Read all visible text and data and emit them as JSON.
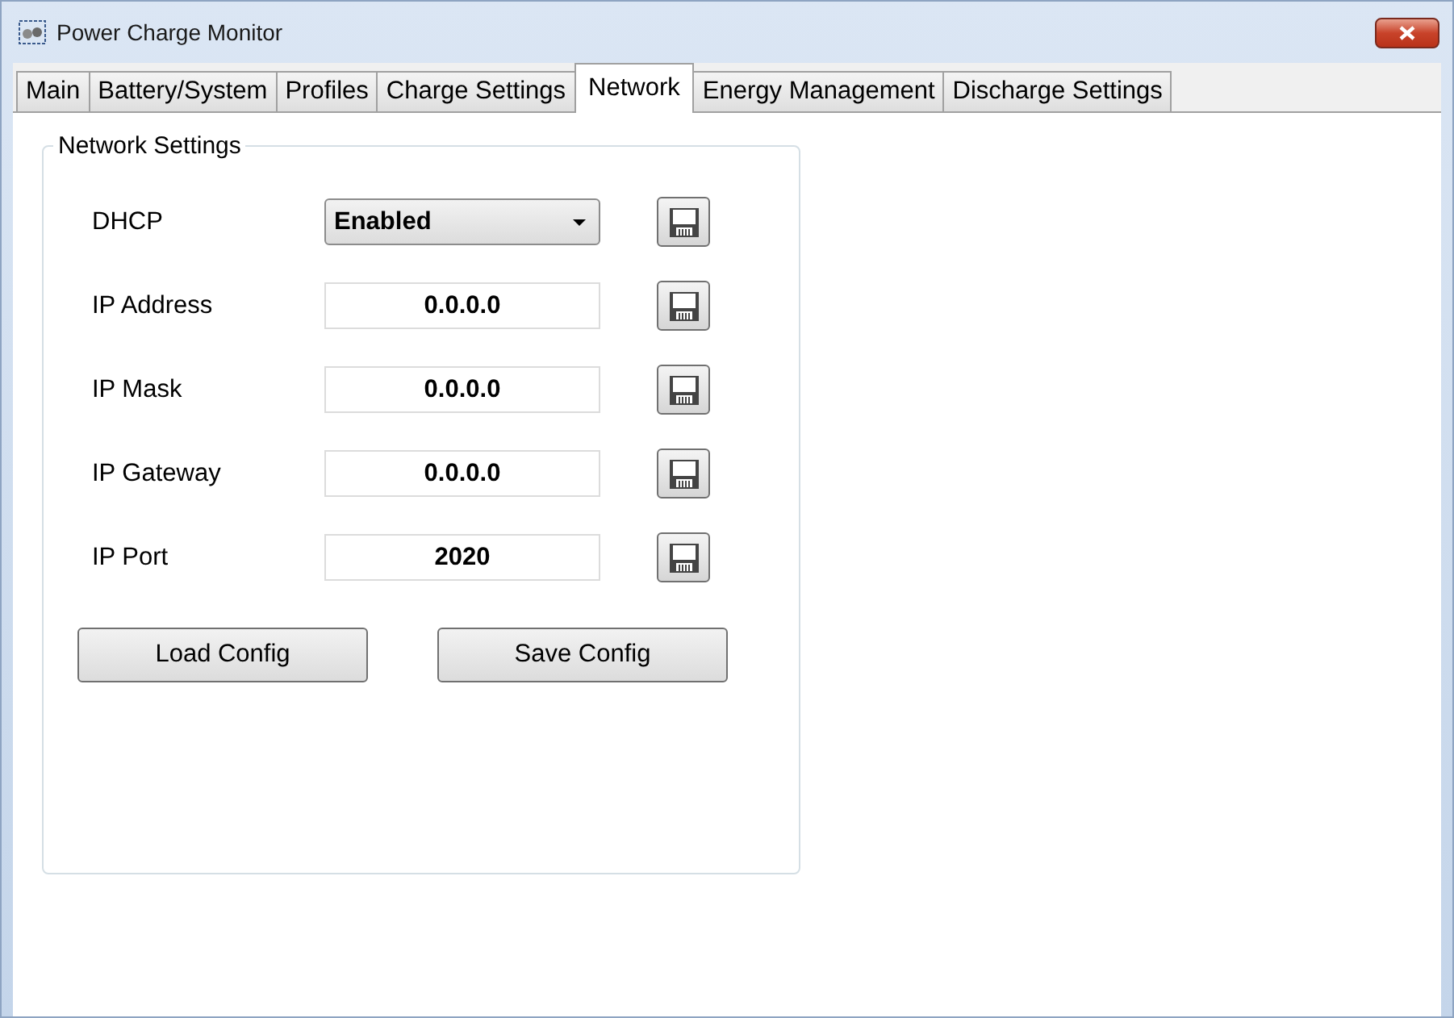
{
  "window": {
    "title": "Power Charge Monitor"
  },
  "tabs": [
    {
      "label": "Main",
      "selected": false
    },
    {
      "label": "Battery/System",
      "selected": false
    },
    {
      "label": "Profiles",
      "selected": false
    },
    {
      "label": "Charge Settings",
      "selected": false
    },
    {
      "label": "Network",
      "selected": true
    },
    {
      "label": "Energy Management",
      "selected": false
    },
    {
      "label": "Discharge Settings",
      "selected": false
    }
  ],
  "group": {
    "title": "Network Settings",
    "fields": [
      {
        "label": "DHCP",
        "kind": "dropdown",
        "value": "Enabled"
      },
      {
        "label": "IP Address",
        "kind": "text",
        "value": "0.0.0.0"
      },
      {
        "label": "IP Mask",
        "kind": "text",
        "value": "0.0.0.0"
      },
      {
        "label": "IP Gateway",
        "kind": "text",
        "value": "0.0.0.0"
      },
      {
        "label": "IP Port",
        "kind": "text",
        "value": "2020"
      }
    ],
    "buttons": [
      "Load Config",
      "Save Config"
    ]
  }
}
